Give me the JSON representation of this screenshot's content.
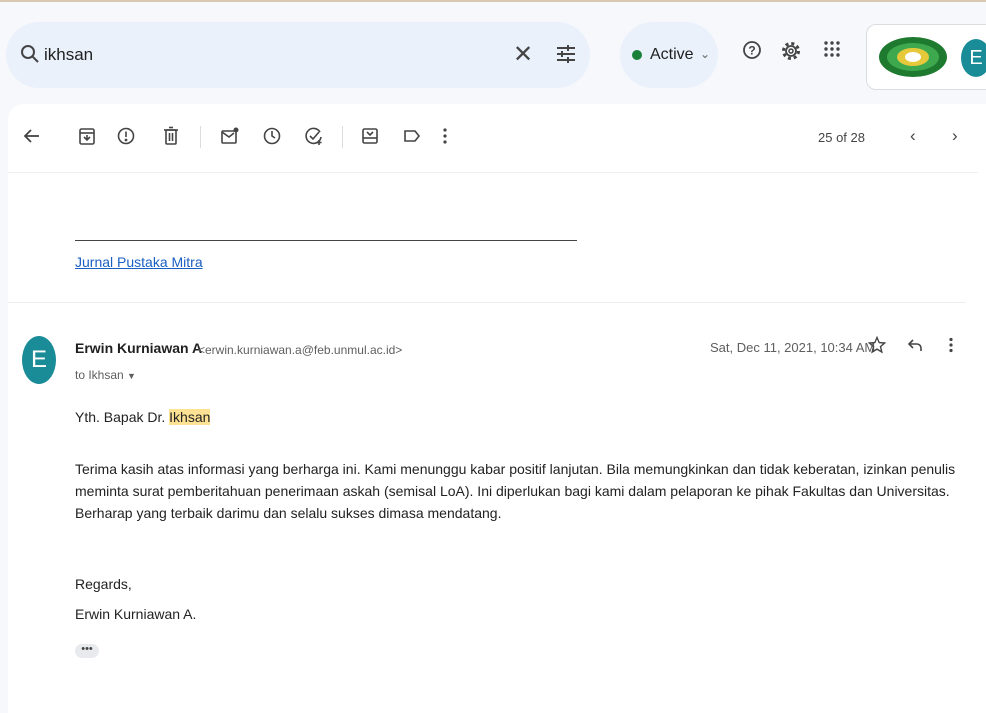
{
  "search": {
    "query": "ikhsan"
  },
  "status": {
    "label": "Active"
  },
  "account": {
    "initial": "E"
  },
  "toolbar": {
    "pager": "25 of 28"
  },
  "email": {
    "signature_link": "Jurnal Pustaka Mitra",
    "sender_initial": "E",
    "sender_name": "Erwin Kurniawan A",
    "sender_email": "<erwin.kurniawan.a@feb.unmul.ac.id>",
    "recipient": "to Ikhsan",
    "date": "Sat, Dec 11, 2021, 10:34 AM",
    "greeting_prefix": "Yth. Bapak Dr.",
    "greeting_highlight": "Ikhsan",
    "body": "Terima kasih atas informasi yang berharga ini. Kami menunggu kabar positif lanjutan. Bila memungkinkan dan tidak keberatan, izinkan penulis meminta surat pemberitahuan penerimaan askah (semisal LoA). Ini diperlukan bagi kami dalam pelaporan ke pihak Fakultas dan Universitas. Berharap yang terbaik darimu dan selalu sukses dimasa mendatang.",
    "closing": "Regards,",
    "signature_name": "Erwin Kurniawan A."
  }
}
